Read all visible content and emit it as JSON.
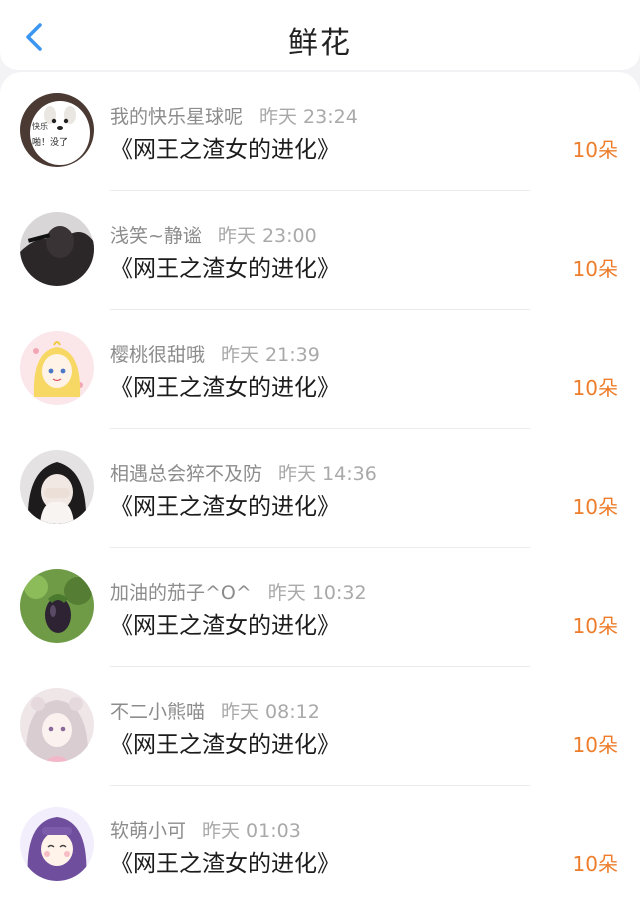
{
  "header": {
    "title": "鲜花",
    "back_icon": "chevron-left-icon"
  },
  "colors": {
    "accent": "#3a96f0",
    "count": "#ee7d2b"
  },
  "items": [
    {
      "user": "我的快乐星球呢",
      "time": "昨天 23:24",
      "book": "《网王之渣女的进化》",
      "count": "10朵",
      "avatar_text": [
        "快乐",
        "啪！没了"
      ]
    },
    {
      "user": "浅笑~静谧",
      "time": "昨天 23:00",
      "book": "《网王之渣女的进化》",
      "count": "10朵"
    },
    {
      "user": "樱桃很甜哦",
      "time": "昨天 21:39",
      "book": "《网王之渣女的进化》",
      "count": "10朵"
    },
    {
      "user": "相遇总会猝不及防",
      "time": "昨天 14:36",
      "book": "《网王之渣女的进化》",
      "count": "10朵"
    },
    {
      "user": "加油的茄子^O^",
      "time": "昨天 10:32",
      "book": "《网王之渣女的进化》",
      "count": "10朵"
    },
    {
      "user": "不二小熊喵",
      "time": "昨天 08:12",
      "book": "《网王之渣女的进化》",
      "count": "10朵"
    },
    {
      "user": "软萌小可",
      "time": "昨天 01:03",
      "book": "《网王之渣女的进化》",
      "count": "10朵"
    }
  ]
}
